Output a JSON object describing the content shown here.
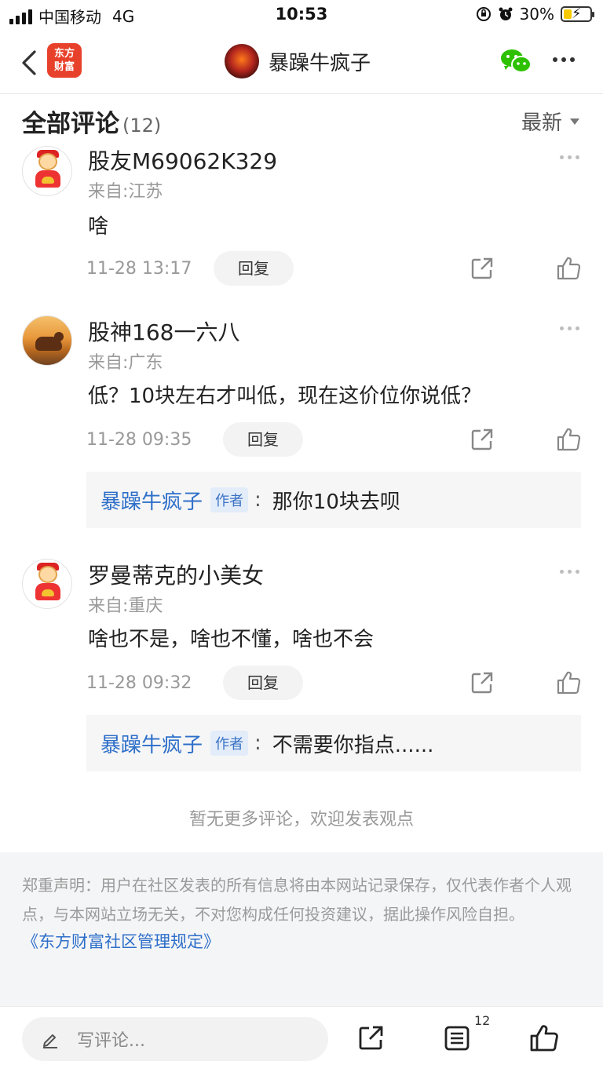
{
  "status_bar": {
    "carrier": "中国移动",
    "network": "4G",
    "time": "10:53",
    "battery": "30%",
    "battery_level": 0.3
  },
  "nav": {
    "logo_line1": "东方",
    "logo_line2": "财富",
    "title": "暴躁牛疯子"
  },
  "comments_header": {
    "title": "全部评论",
    "count": "(12)",
    "sort_label": "最新"
  },
  "comments": [
    {
      "name": "股友M69062K329",
      "location": "来自:江苏",
      "text": "啥",
      "time": "11-28 13:17",
      "reply_label": "回复"
    },
    {
      "name": "股神168一六八",
      "location": "来自:广东",
      "text": "低？10块左右才叫低，现在这价位你说低？",
      "time": "11-28 09:35",
      "reply_label": "回复",
      "author_reply": {
        "name": "暴躁牛疯子",
        "tag": "作者",
        "colon": ":",
        "text": "那你10块去呗"
      }
    },
    {
      "name": "罗曼蒂克的小美女",
      "location": "来自:重庆",
      "text": "啥也不是，啥也不懂，啥也不会",
      "time": "11-28 09:32",
      "reply_label": "回复",
      "author_reply": {
        "name": "暴躁牛疯子",
        "tag": "作者",
        "colon": ":",
        "text": "不需要你指点......"
      }
    }
  ],
  "no_more_text": "暂无更多评论，欢迎发表观点",
  "disclaimer": {
    "text": "郑重声明：用户在社区发表的所有信息将由本网站记录保存，仅代表作者个人观点，与本网站立场无关，不对您构成任何投资建议，据此操作风险自担。",
    "rules_link": "《东方财富社区管理规定》"
  },
  "bottom_bar": {
    "input_placeholder": "写评论...",
    "comment_count": "12"
  }
}
